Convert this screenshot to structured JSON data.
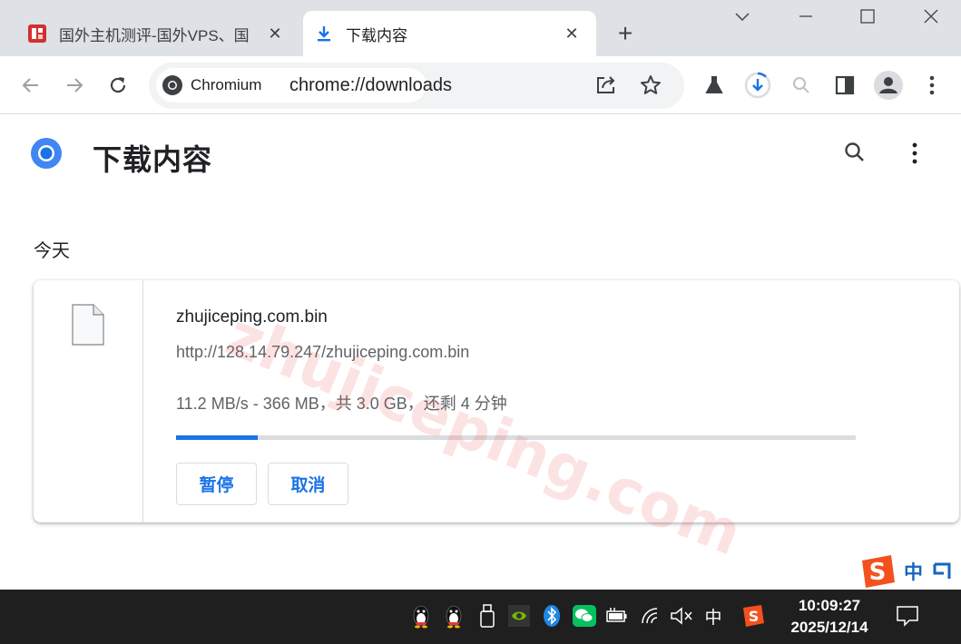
{
  "browser": {
    "tabs": [
      {
        "title": "国外主机测评-国外VPS、国",
        "favicon": "site-favicon-icon",
        "active": false
      },
      {
        "title": "下载内容",
        "favicon": "download-icon",
        "active": true
      }
    ],
    "omnibox": {
      "chip_label": "Chromium",
      "url": "chrome://downloads"
    },
    "accent_color": "#1a73e8"
  },
  "page": {
    "title": "下载内容",
    "section_date": "今天",
    "download": {
      "filename": "zhujiceping.com.bin",
      "url": "http://128.14.79.247/zhujiceping.com.bin",
      "status": "11.2 MB/s - 366 MB，共 3.0 GB，还剩 4 分钟",
      "progress_fraction": 0.12,
      "pause_label": "暂停",
      "cancel_label": "取消"
    }
  },
  "watermark": "zhujiceping.com",
  "ime": {
    "mode_label": "中"
  },
  "taskbar": {
    "tray_ime_label": "中",
    "time": "10:09:27",
    "date": "2025/12/14"
  }
}
